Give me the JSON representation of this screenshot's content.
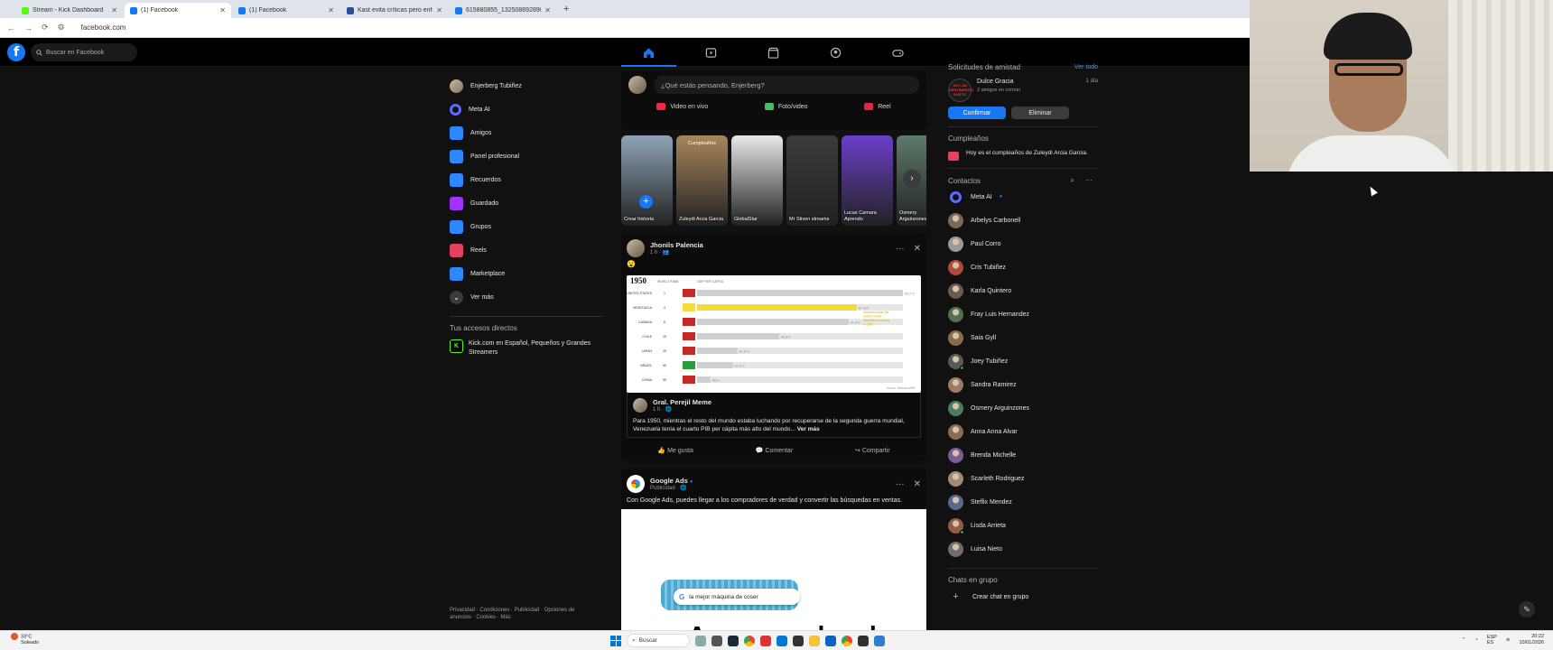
{
  "browser": {
    "tabs": [
      {
        "title": "Stream - Kick Dashboard",
        "color": "#53fc18",
        "active": false
      },
      {
        "title": "(1) Facebook",
        "color": "#1877f2",
        "active": true
      },
      {
        "title": "(1) Facebook",
        "color": "#1877f2",
        "active": false
      },
      {
        "title": "Kast evita críticas pero enfoca...",
        "color": "#2b4d9c",
        "active": false
      },
      {
        "title": "615880855_1325086928986...",
        "color": "#1877f2",
        "active": false
      }
    ],
    "url": "facebook.com"
  },
  "fb": {
    "logo": "f",
    "search_placeholder": "Buscar en Facebook"
  },
  "leftnav": {
    "items": [
      {
        "label": "Enjerberg Tubiñez",
        "icon": "avatar",
        "color": "#8a7560"
      },
      {
        "label": "Meta AI",
        "icon": "meta-ai-icon",
        "color": "#5b6cff"
      },
      {
        "label": "Amigos",
        "icon": "friends-icon",
        "color": "#2d88ff"
      },
      {
        "label": "Panel profesional",
        "icon": "dashboard-icon",
        "color": "#2d88ff"
      },
      {
        "label": "Recuerdos",
        "icon": "clock-icon",
        "color": "#2d88ff"
      },
      {
        "label": "Guardado",
        "icon": "bookmark-icon",
        "color": "#a033ff"
      },
      {
        "label": "Grupos",
        "icon": "groups-icon",
        "color": "#2d88ff"
      },
      {
        "label": "Reels",
        "icon": "reels-icon",
        "color": "#e4405f"
      },
      {
        "label": "Marketplace",
        "icon": "marketplace-icon",
        "color": "#2d88ff"
      },
      {
        "label": "Ver más",
        "icon": "chevron-down-icon",
        "color": "#3a3b3c"
      }
    ],
    "shortcuts_title": "Tus accesos directos",
    "shortcut": "Kick.com en Español, Pequeños y Grandes Streamers",
    "footer": "Privacidad · Condiciones · Publicidad · Opciones de anuncios · Cookies · Más"
  },
  "composer": {
    "placeholder": "¿Qué estás pensando, Enjerberg?",
    "live": "Video en vivo",
    "photo": "Foto/video",
    "reel": "Reel"
  },
  "stories": [
    {
      "name": "Crear historia",
      "top": "",
      "bg": "#8fa4b7"
    },
    {
      "name": "Zuleydi Arcia Garcia",
      "top": "Cumpleaños",
      "bg": "#a9865c"
    },
    {
      "name": "GlobalStar",
      "top": "",
      "bg": "#e9e9e9"
    },
    {
      "name": "Mr Stiven streams",
      "top": "",
      "bg": "#3b3b3b"
    },
    {
      "name": "Lucas Camara Aprendo",
      "top": "",
      "bg": "#6b3fc9"
    },
    {
      "name": "Osmery Arguinzones",
      "top": "",
      "bg": "#5d7b6b"
    }
  ],
  "post1": {
    "author": "Jhonils Palencia",
    "meta": "1 h · ",
    "emoji": "😮",
    "shared_author": "Gral. Perejil Meme",
    "shared_meta": "1 h · ",
    "text": "Para 1950, mientras el resto del mundo estaba luchando por recuperarse de la segunda guerra mundial, Venezuela tenía el cuarto PIB per cápita más alto del mundo...",
    "more": "Ver más",
    "like": "Me gusta",
    "comment": "Comentar",
    "share": "Compartir"
  },
  "chart_data": {
    "type": "bar",
    "title": "1950",
    "xlabel": "GDP PER CAPITA",
    "ylabel": "WORLD RANK",
    "categories": [
      "UNITED STATES",
      "VENEZUELA",
      "CANADA",
      "CHILE",
      "JAPAN",
      "BRAZIL",
      "CHINA"
    ],
    "ranks": [
      "1",
      "4",
      "6",
      "15",
      "25",
      "50",
      "65"
    ],
    "values": [
      9573,
      7424,
      7047,
      3827,
      1873,
      1672,
      614
    ],
    "value_labels": [
      "$9,573",
      "$7,424",
      "$7,047",
      "$3,827",
      "$1,873",
      "$1,672",
      "$614"
    ],
    "colors": [
      "#cfcfcf",
      "#f2dc3c",
      "#cfcfcf",
      "#cfcfcf",
      "#cfcfcf",
      "#cfcfcf",
      "#cfcfcf"
    ],
    "annotation": "Venezuela was the world's fourth wealthiest economy in 1950",
    "source": "Source: Maddison/IMF",
    "ylim": [
      0,
      9573
    ]
  },
  "post2": {
    "author": "Google Ads",
    "meta": "Publicidad · ",
    "text": "Con Google Ads, puedes llegar a los compradores de verdad y convertir las búsquedas en ventas.",
    "search_text": "la mejor máquina de coser",
    "big_text": "Aparece donde"
  },
  "right": {
    "requests_title": "Solicitudes de amistad",
    "see_all": "Ver todo",
    "request_name": "Dulce Gracia",
    "request_time": "1 día",
    "request_badge": "SOY UN SENTIMIENTO GUSTO",
    "mutual": "2 amigos en común",
    "confirm": "Confirmar",
    "delete": "Eliminar",
    "birthdays_title": "Cumpleaños",
    "birthday_text": "Hoy es el cumpleaños de Zuleydi Arcia Garcia.",
    "contacts_title": "Contactos",
    "contacts": [
      {
        "name": "Meta AI",
        "meta": true,
        "color": "#5b6cff",
        "online": false
      },
      {
        "name": "Arbelys Carbonell",
        "meta": false,
        "color": "#7d6a55",
        "online": false
      },
      {
        "name": "Paul Corro",
        "meta": false,
        "color": "#9a9a9a",
        "online": false
      },
      {
        "name": "Cris Tubiñez",
        "meta": false,
        "color": "#b04a3a",
        "online": false
      },
      {
        "name": "Karla Quintero",
        "meta": false,
        "color": "#6c5a4c",
        "online": false
      },
      {
        "name": "Fray Luis Hernandez",
        "meta": false,
        "color": "#557050",
        "online": false
      },
      {
        "name": "Saia Gyll",
        "meta": false,
        "color": "#8a6c4a",
        "online": false
      },
      {
        "name": "Joey Tubiñez",
        "meta": false,
        "color": "#5a5a5a",
        "online": true
      },
      {
        "name": "Sandra Ramirez",
        "meta": false,
        "color": "#9c7c66",
        "online": false
      },
      {
        "name": "Osmery Arguinzones",
        "meta": false,
        "color": "#4f7b64",
        "online": false
      },
      {
        "name": "Anna Anna Alvar",
        "meta": false,
        "color": "#8b6a56",
        "online": false
      },
      {
        "name": "Brenda Michelle",
        "meta": false,
        "color": "#7a5d92",
        "online": false
      },
      {
        "name": "Scarleth Rodriguez",
        "meta": false,
        "color": "#a48a74",
        "online": false
      },
      {
        "name": "Steflix Mendez",
        "meta": false,
        "color": "#5b6a8a",
        "online": false
      },
      {
        "name": "Lisda Arrieta",
        "meta": false,
        "color": "#8d5e48",
        "online": true
      },
      {
        "name": "Luisa Nieto",
        "meta": false,
        "color": "#6e6e6e",
        "online": false
      }
    ],
    "group_chats_title": "Chats en grupo",
    "create_group": "Crear chat en grupo"
  },
  "taskbar": {
    "temp": "33°C",
    "weather": "Soleado",
    "search": "Buscar",
    "time": "20:22",
    "date": "10/01/2026",
    "lang": "ESP\nES"
  }
}
